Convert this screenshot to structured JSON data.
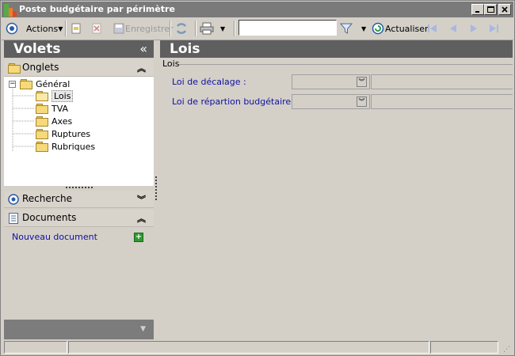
{
  "window": {
    "title": "Poste budgétaire par périmètre"
  },
  "toolbar": {
    "actions_label": "Actions",
    "save_label": "Enregistrer",
    "search_value": "",
    "refresh_label": "Actualiser"
  },
  "left_pane": {
    "title": "Volets",
    "onglets_label": "Onglets",
    "tree": {
      "root": "Général",
      "items": [
        "Lois",
        "TVA",
        "Axes",
        "Ruptures",
        "Rubriques"
      ],
      "selected": "Lois"
    },
    "search_label": "Recherche",
    "documents_label": "Documents",
    "new_document_label": "Nouveau document"
  },
  "main": {
    "title": "Lois",
    "group_title": "Lois",
    "fields": [
      {
        "label": "Loi de décalage :",
        "value": ""
      },
      {
        "label": "Loi de répartion budgétaire :",
        "value": ""
      }
    ]
  },
  "colors": {
    "header_bg": "#5f5f5f",
    "link": "#1010a0",
    "window_bg": "#d4d0c8"
  }
}
